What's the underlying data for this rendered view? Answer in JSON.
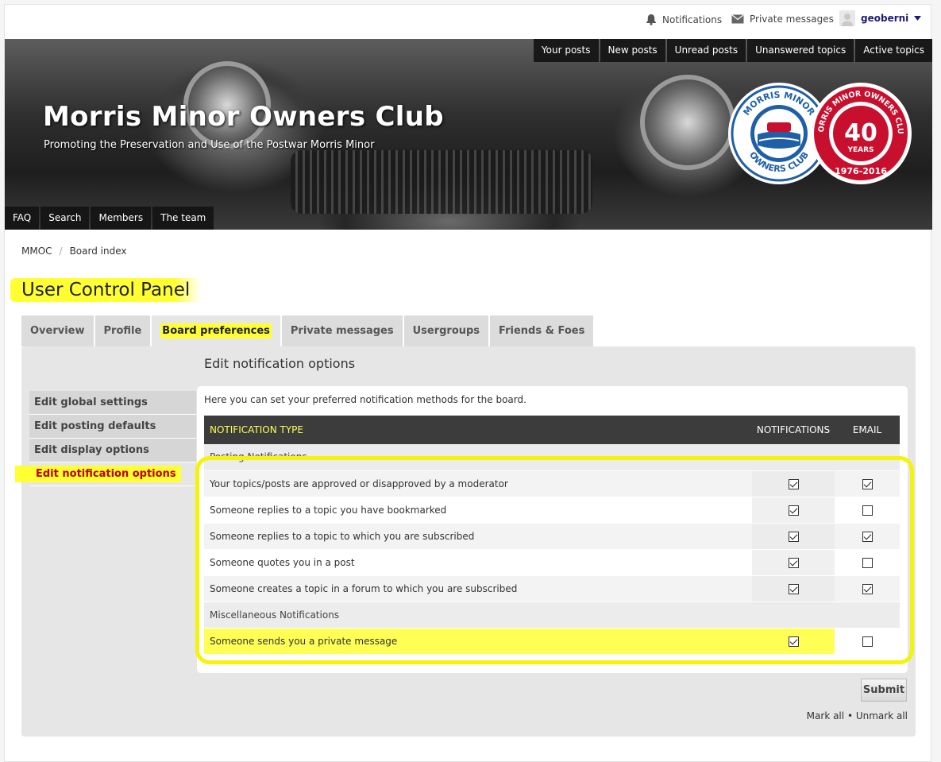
{
  "topbar": {
    "notifications": "Notifications",
    "private_messages": "Private messages",
    "username": "geoberni"
  },
  "header": {
    "site_title": "Morris Minor Owners Club",
    "site_description": "Promoting the Preservation and Use of the Postwar Morris Minor",
    "quick_links": [
      "Your posts",
      "New posts",
      "Unread posts",
      "Unanswered topics",
      "Active topics"
    ],
    "nav_links": [
      "FAQ",
      "Search",
      "Members",
      "The team"
    ],
    "logo_left": {
      "top_text": "MORRIS MINOR",
      "bottom_text": "OWNERS CLUB"
    },
    "logo_right": {
      "ring_text": "MORRIS MINOR OWNERS CLUB",
      "number": "40",
      "word": "YEARS",
      "range": "1976-2016"
    },
    "accent_red": "#c8102e",
    "accent_blue": "#1f5fa8"
  },
  "breadcrumb": [
    "MMOC",
    "Board index"
  ],
  "ucp": {
    "title": "User Control Panel",
    "tabs": [
      "Overview",
      "Profile",
      "Board preferences",
      "Private messages",
      "Usergroups",
      "Friends & Foes"
    ],
    "active_tab": "Board preferences",
    "heading": "Edit notification options",
    "side_menu": [
      "Edit global settings",
      "Edit posting defaults",
      "Edit display options",
      "Edit notification options"
    ],
    "active_side": "Edit notification options",
    "intro": "Here you can set your preferred notification methods for the board.",
    "columns": {
      "type": "NOTIFICATION TYPE",
      "notifications": "NOTIFICATIONS",
      "email": "EMAIL"
    },
    "groups": [
      {
        "name": "Posting Notifications",
        "rows": [
          {
            "label": "Your topics/posts are approved or disapproved by a moderator",
            "notification": true,
            "email": true
          },
          {
            "label": "Someone replies to a topic you have bookmarked",
            "notification": true,
            "email": false
          },
          {
            "label": "Someone replies to a topic to which you are subscribed",
            "notification": true,
            "email": true
          },
          {
            "label": "Someone quotes you in a post",
            "notification": true,
            "email": false
          },
          {
            "label": "Someone creates a topic in a forum to which you are subscribed",
            "notification": true,
            "email": true
          }
        ]
      },
      {
        "name": "Miscellaneous Notifications",
        "rows": [
          {
            "label": "Someone sends you a private message",
            "notification": true,
            "email": false
          }
        ]
      }
    ],
    "submit": "Submit",
    "mark_all": "Mark all",
    "bullet": "•",
    "unmark_all": "Unmark all"
  }
}
